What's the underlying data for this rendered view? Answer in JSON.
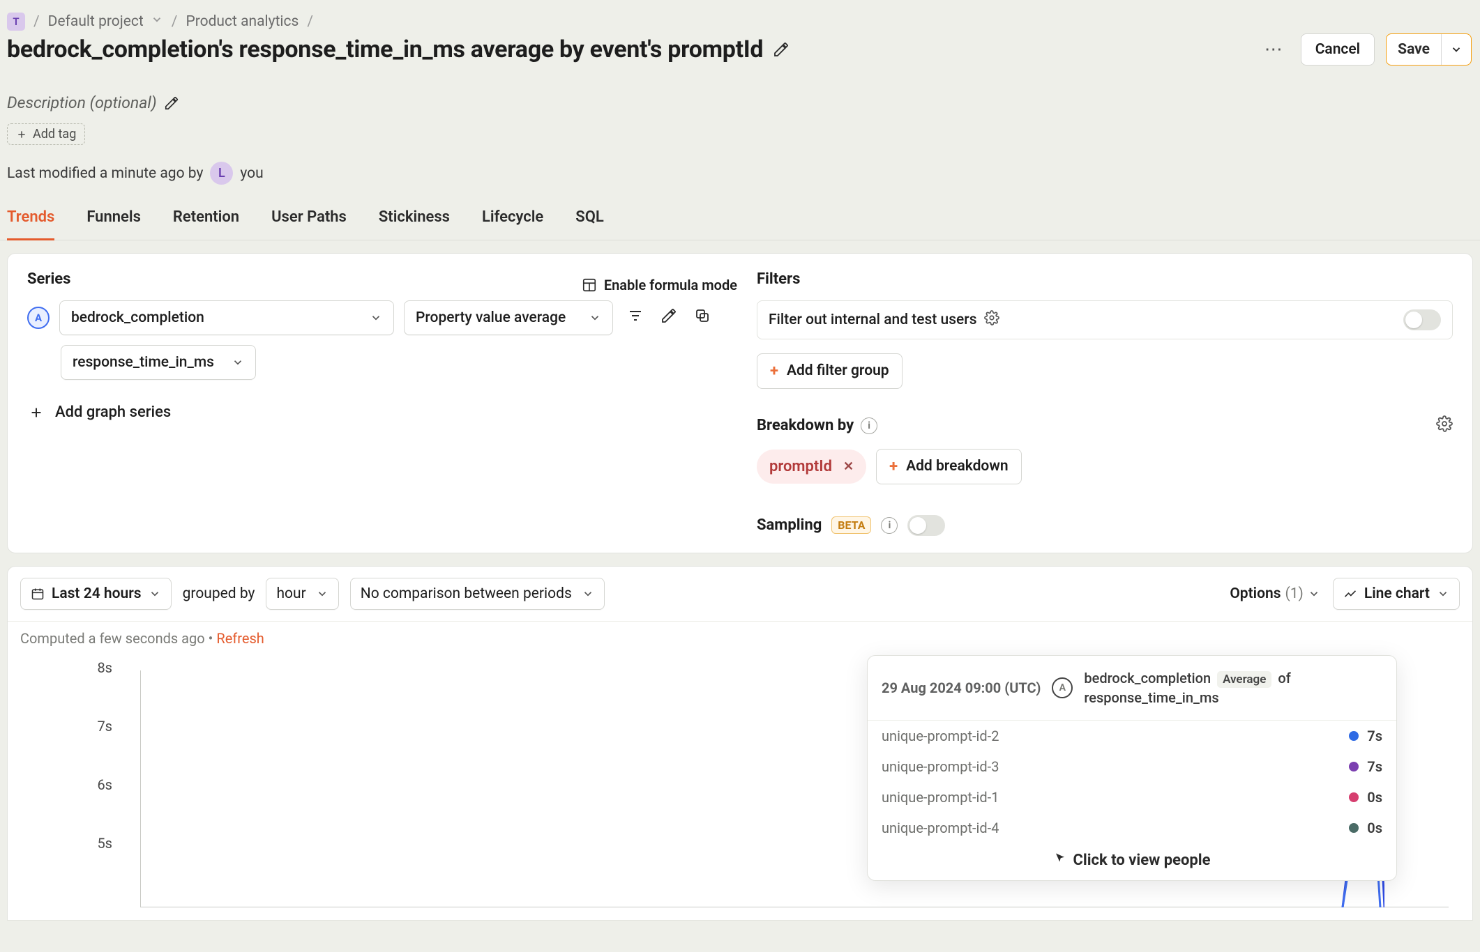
{
  "breadcrumb": {
    "org_letter": "T",
    "project": "Default project",
    "section": "Product analytics"
  },
  "page_title": "bedrock_completion's response_time_in_ms average by event's promptId",
  "actions": {
    "cancel": "Cancel",
    "save": "Save"
  },
  "description_placeholder": "Description (optional)",
  "add_tag_label": "Add tag",
  "last_modified": {
    "prefix": "Last modified a minute ago by",
    "avatar_letter": "L",
    "who": "you"
  },
  "tabs": [
    "Trends",
    "Funnels",
    "Retention",
    "User Paths",
    "Stickiness",
    "Lifecycle",
    "SQL"
  ],
  "active_tab": "Trends",
  "series": {
    "title": "Series",
    "enable_formula": "Enable formula mode",
    "event": "bedrock_completion",
    "aggregation": "Property value average",
    "property": "response_time_in_ms",
    "add_series": "Add graph series",
    "badge_letter": "A"
  },
  "filters": {
    "title": "Filters",
    "internal_label": "Filter out internal and test users",
    "add_filter_group": "Add filter group",
    "breakdown_label": "Breakdown by",
    "breakdown_value": "promptId",
    "add_breakdown": "Add breakdown",
    "sampling_label": "Sampling",
    "sampling_badge": "BETA"
  },
  "chart_toolbar": {
    "range": "Last 24 hours",
    "grouped_by_text": "grouped by",
    "group_unit": "hour",
    "comparison": "No comparison between periods",
    "options_label": "Options",
    "options_count": "(1)",
    "chart_type": "Line chart"
  },
  "computed": {
    "text": "Computed a few seconds ago",
    "sep": "•",
    "refresh": "Refresh"
  },
  "chart_data": {
    "type": "line",
    "xlabel": "",
    "ylabel": "",
    "ylim": [
      0,
      8
    ],
    "y_ticks": [
      "8s",
      "7s",
      "6s",
      "5s"
    ],
    "tooltip": {
      "time": "29 Aug 2024 09:00 (UTC)",
      "badge": "A",
      "event": "bedrock_completion",
      "agg_badge": "Average",
      "suffix": "of",
      "property": "response_time_in_ms",
      "rows": [
        {
          "label": "unique-prompt-id-2",
          "value": "7s",
          "color": "#2f6be4"
        },
        {
          "label": "unique-prompt-id-3",
          "value": "7s",
          "color": "#7b3fb0"
        },
        {
          "label": "unique-prompt-id-1",
          "value": "0s",
          "color": "#d63e6f"
        },
        {
          "label": "unique-prompt-id-4",
          "value": "0s",
          "color": "#4a6b66"
        }
      ],
      "footer": "Click to view people"
    }
  }
}
